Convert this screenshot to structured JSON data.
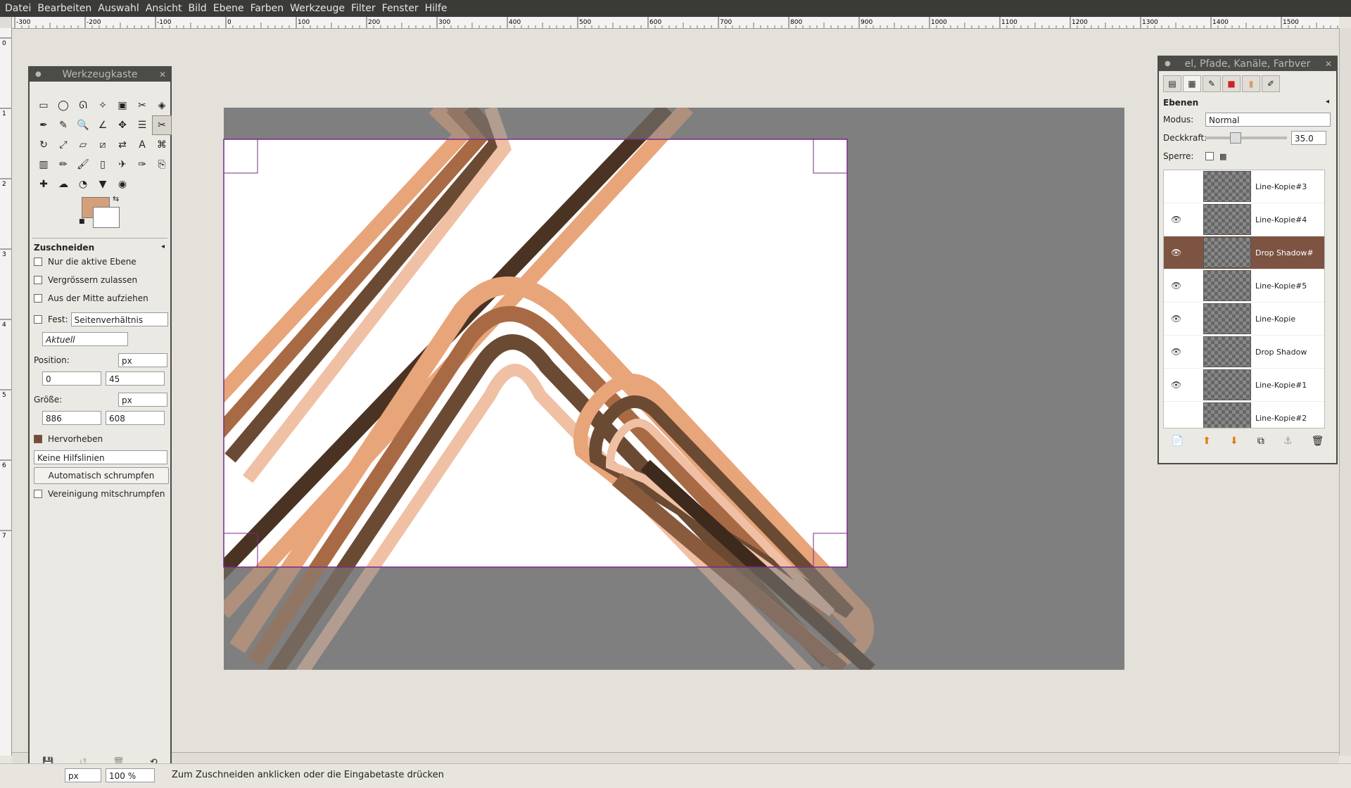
{
  "menu": [
    "Datei",
    "Bearbeiten",
    "Auswahl",
    "Ansicht",
    "Bild",
    "Ebene",
    "Farben",
    "Werkzeuge",
    "Filter",
    "Fenster",
    "Hilfe"
  ],
  "ruler": {
    "h_labels": [
      "-300",
      "-200",
      "-100",
      "0",
      "100",
      "200",
      "300",
      "400",
      "500",
      "600",
      "700",
      "800",
      "900",
      "1000",
      "1100",
      "1200",
      "1300",
      "1400",
      "1500"
    ],
    "v_labels": [
      "0",
      "1",
      "2",
      "3",
      "4",
      "5",
      "6",
      "7"
    ]
  },
  "toolbox": {
    "title": "Werkzeugkaste",
    "tool_icons": [
      "rect-select-icon",
      "ellipse-select-icon",
      "free-select-icon",
      "fuzzy-select-icon",
      "color-select-icon",
      "scissors-icon",
      "foreground-select-icon",
      "paths-icon",
      "color-picker-icon",
      "zoom-icon",
      "measure-icon",
      "move-icon",
      "align-icon",
      "crop-icon",
      "rotate-icon",
      "scale-icon",
      "shear-icon",
      "perspective-icon",
      "flip-icon",
      "text-icon",
      "cage-icon",
      "blend-icon",
      "pencil-icon",
      "paintbrush-icon",
      "eraser-icon",
      "airbrush-icon",
      "ink-icon",
      "clone-icon",
      "heal-icon",
      "smudge-icon",
      "dodge-icon",
      "bucket-icon",
      "convolve-icon"
    ],
    "fg_color": "#d4a07a",
    "bg_color": "#ffffff"
  },
  "options": {
    "title": "Zuschneiden",
    "only_active_layer": "Nur die aktive Ebene",
    "allow_growing": "Vergrössern zulassen",
    "expand_center": "Aus der Mitte aufziehen",
    "fixed_label": "Fest:",
    "fixed_value": "Seitenverhältnis",
    "current_value": "Aktuell",
    "position_label": "Position:",
    "position_unit": "px",
    "position_x": "0",
    "position_y": "45",
    "size_label": "Größe:",
    "size_unit": "px",
    "size_w": "886",
    "size_h": "608",
    "highlight": "Hervorheben",
    "guides": "Keine Hilfslinien",
    "auto_shrink": "Automatisch schrumpfen",
    "shrink_merged": "Vereinigung mitschrumpfen"
  },
  "layers_panel": {
    "title": "el, Pfade, Kanäle, Farbver",
    "section": "Ebenen",
    "mode_label": "Modus:",
    "mode_value": "Normal",
    "opacity_label": "Deckkraft:",
    "opacity_value": "35.0",
    "lock_label": "Sperre:",
    "layers": [
      {
        "name": "Line-Kopie#3",
        "visible": false,
        "selected": false
      },
      {
        "name": "Line-Kopie#4",
        "visible": true,
        "selected": false
      },
      {
        "name": "Drop Shadow#",
        "visible": true,
        "selected": true
      },
      {
        "name": "Line-Kopie#5",
        "visible": true,
        "selected": false
      },
      {
        "name": "Line-Kopie",
        "visible": true,
        "selected": false
      },
      {
        "name": "Drop Shadow",
        "visible": true,
        "selected": false
      },
      {
        "name": "Line-Kopie#1",
        "visible": true,
        "selected": false
      },
      {
        "name": "Line-Kopie#2",
        "visible": false,
        "selected": false
      }
    ]
  },
  "status": {
    "unit": "px",
    "zoom": "100 %",
    "message": "Zum Zuschneiden anklicken oder die Eingabetaste drücken"
  }
}
